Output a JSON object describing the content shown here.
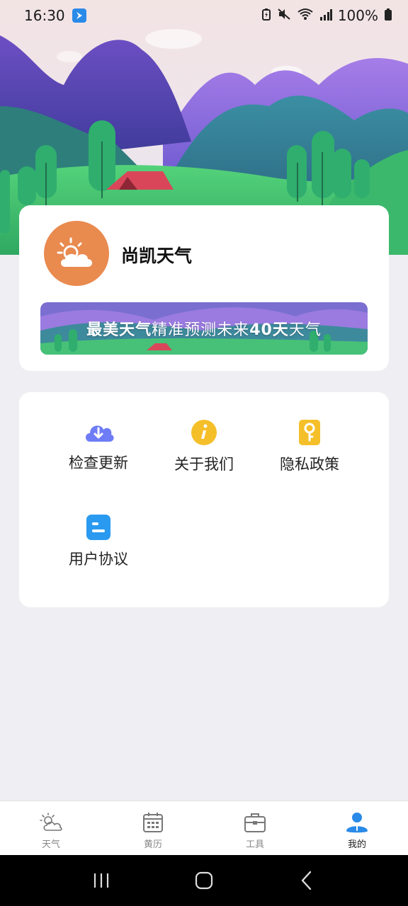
{
  "status_bar": {
    "time": "16:30",
    "battery": "100%"
  },
  "app": {
    "name": "尚凯天气",
    "logo_icon": "sun-cloud-icon",
    "logo_color": "#e98a4f"
  },
  "banner": {
    "bold_1": "最美天气",
    "text_1": "精准预测未来",
    "bold_2": "40天",
    "text_2": "天气"
  },
  "menu": {
    "items": [
      {
        "label": "检查更新",
        "icon": "cloud-download-icon",
        "color": "#6e7cf6"
      },
      {
        "label": "关于我们",
        "icon": "info-icon",
        "color": "#f5bf2a"
      },
      {
        "label": "隐私政策",
        "icon": "key-icon",
        "color": "#f5bf2a"
      },
      {
        "label": "用户协议",
        "icon": "document-icon",
        "color": "#2a9af0"
      }
    ]
  },
  "bottom_nav": {
    "items": [
      {
        "label": "天气",
        "icon": "weather-icon"
      },
      {
        "label": "黄历",
        "icon": "calendar-icon"
      },
      {
        "label": "工具",
        "icon": "toolbox-icon"
      },
      {
        "label": "我的",
        "icon": "profile-icon",
        "active": true
      }
    ],
    "active_color": "#2a8ae8"
  }
}
